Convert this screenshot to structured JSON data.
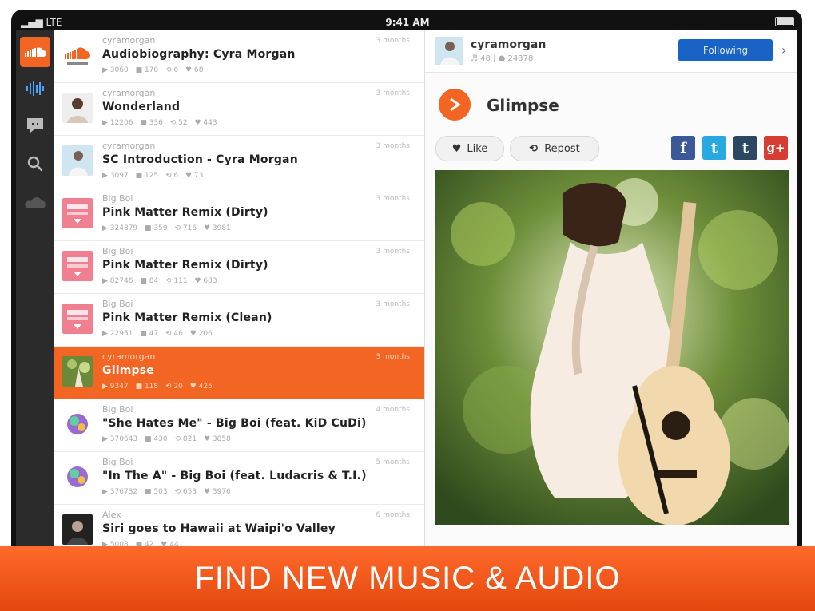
{
  "status": {
    "carrier": "LTE",
    "time": "9:41 AM"
  },
  "nav": {
    "items": [
      {
        "name": "soundcloud-logo",
        "active": true
      },
      {
        "name": "stream",
        "active": false
      },
      {
        "name": "activity",
        "active": false
      },
      {
        "name": "search",
        "active": false
      },
      {
        "name": "you",
        "active": false
      }
    ]
  },
  "tracks": [
    {
      "user": "cyramorgan",
      "title": "Audiobiography: Cyra Morgan",
      "plays": "3060",
      "comments": "170",
      "reposts": "6",
      "likes": "68",
      "age": "3 months"
    },
    {
      "user": "cyramorgan",
      "title": "Wonderland",
      "plays": "12206",
      "comments": "336",
      "reposts": "52",
      "likes": "443",
      "age": "3 months"
    },
    {
      "user": "cyramorgan",
      "title": "SC Introduction - Cyra Morgan",
      "plays": "3097",
      "comments": "125",
      "reposts": "6",
      "likes": "73",
      "age": "3 months"
    },
    {
      "user": "Big Boi",
      "title": "Pink Matter Remix (Dirty)",
      "plays": "324879",
      "comments": "359",
      "reposts": "716",
      "likes": "3981",
      "age": "3 months"
    },
    {
      "user": "Big Boi",
      "title": "Pink Matter Remix (Dirty)",
      "plays": "82746",
      "comments": "84",
      "reposts": "111",
      "likes": "683",
      "age": "3 months"
    },
    {
      "user": "Big Boi",
      "title": "Pink Matter Remix (Clean)",
      "plays": "22951",
      "comments": "47",
      "reposts": "46",
      "likes": "206",
      "age": "3 months"
    },
    {
      "user": "cyramorgan",
      "title": "Glimpse",
      "plays": "9347",
      "comments": "118",
      "reposts": "20",
      "likes": "425",
      "age": "3 months",
      "active": true
    },
    {
      "user": "Big Boi",
      "title": "\"She Hates Me\" - Big Boi (feat. KiD CuDi)",
      "plays": "370643",
      "comments": "430",
      "reposts": "821",
      "likes": "3858",
      "age": "4 months"
    },
    {
      "user": "Big Boi",
      "title": "\"In The A\" - Big Boi (feat. Ludacris & T.I.)",
      "plays": "376732",
      "comments": "503",
      "reposts": "653",
      "likes": "3976",
      "age": "5 months"
    },
    {
      "user": "Alex",
      "title": "Siri goes to Hawaii at Waipi'o Valley",
      "plays": "5008",
      "comments": "42",
      "reposts": "",
      "likes": "44",
      "age": "6 months"
    }
  ],
  "detail": {
    "user": "cyramorgan",
    "tracks_count": "48",
    "followers": "24378",
    "follow_label": "Following",
    "track_title": "Glimpse",
    "like_label": "Like",
    "repost_label": "Repost",
    "share": {
      "facebook": "f",
      "twitter": "t",
      "tumblr": "t",
      "google_plus": "g+"
    }
  },
  "banner": {
    "text": "FIND NEW MUSIC & AUDIO"
  },
  "colors": {
    "accent": "#f26522",
    "follow": "#1a63c6"
  }
}
